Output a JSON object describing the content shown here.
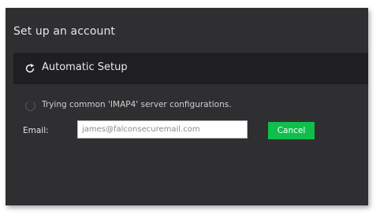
{
  "window": {
    "title": "Set up an account"
  },
  "automatic_setup": {
    "label": "Automatic Setup",
    "icon": "refresh-icon"
  },
  "status": {
    "icon": "spinner-icon",
    "text": "Trying common 'IMAP4' server configurations."
  },
  "email": {
    "label": "Email:",
    "value": "james@falconsecuremail.com"
  },
  "buttons": {
    "cancel_label": "Cancel"
  },
  "colors": {
    "window_background": "#2f2f31",
    "header_background": "#1f1f21",
    "accent_green": "#0fbf4c"
  }
}
